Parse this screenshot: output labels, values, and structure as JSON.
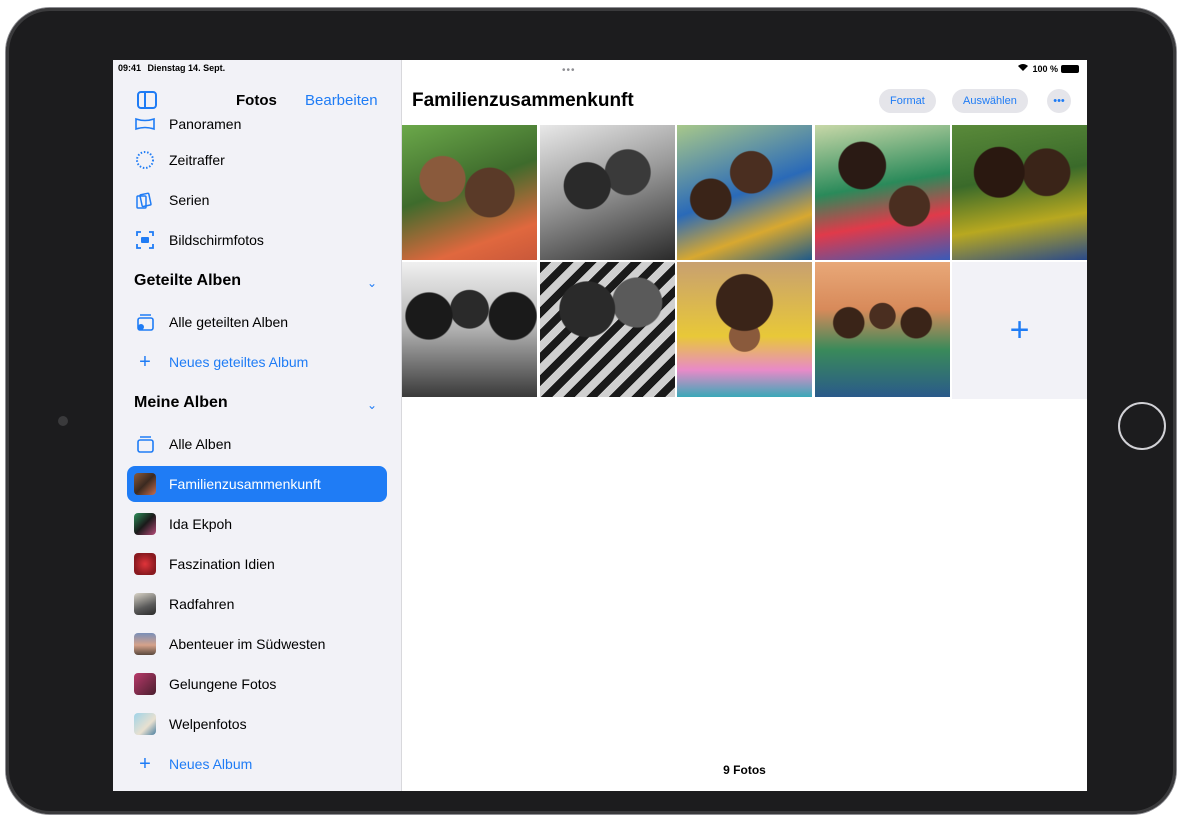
{
  "status_bar": {
    "time": "09:41",
    "date": "Dienstag 14. Sept.",
    "battery": "100 %",
    "multitask_dots": "•••"
  },
  "sidebar": {
    "title": "Fotos",
    "edit_label": "Bearbeiten",
    "media_types": [
      {
        "label": "Panoramen",
        "icon": "panorama-icon"
      },
      {
        "label": "Zeitraffer",
        "icon": "timelapse-icon"
      },
      {
        "label": "Serien",
        "icon": "burst-icon"
      },
      {
        "label": "Bildschirmfotos",
        "icon": "screenshot-icon"
      }
    ],
    "shared_albums": {
      "header": "Geteilte Alben",
      "items": [
        {
          "label": "Alle geteilten Alben",
          "icon": "shared-albums-icon"
        },
        {
          "label": "Neues geteiltes Album",
          "icon": "plus-icon"
        }
      ]
    },
    "my_albums": {
      "header": "Meine Alben",
      "items": [
        {
          "label": "Alle Alben",
          "icon": "albums-stack-icon"
        },
        {
          "label": "Familienzusammenkunft",
          "selected": true
        },
        {
          "label": "Ida Ekpoh"
        },
        {
          "label": "Faszination Idien"
        },
        {
          "label": "Radfahren"
        },
        {
          "label": "Abenteuer im Südwesten"
        },
        {
          "label": "Gelungene Fotos"
        },
        {
          "label": "Welpenfotos"
        },
        {
          "label": "Neues Album",
          "icon": "plus-icon"
        }
      ]
    }
  },
  "main": {
    "title": "Familienzusammenkunft",
    "format_label": "Format",
    "select_label": "Auswählen",
    "more_label": "•••",
    "photo_count": "9 Fotos",
    "add_label": "+"
  },
  "colors": {
    "accent": "#1f7cf5",
    "sidebar_bg": "#f2f2f7",
    "selected_bg": "#1f7cf5"
  }
}
